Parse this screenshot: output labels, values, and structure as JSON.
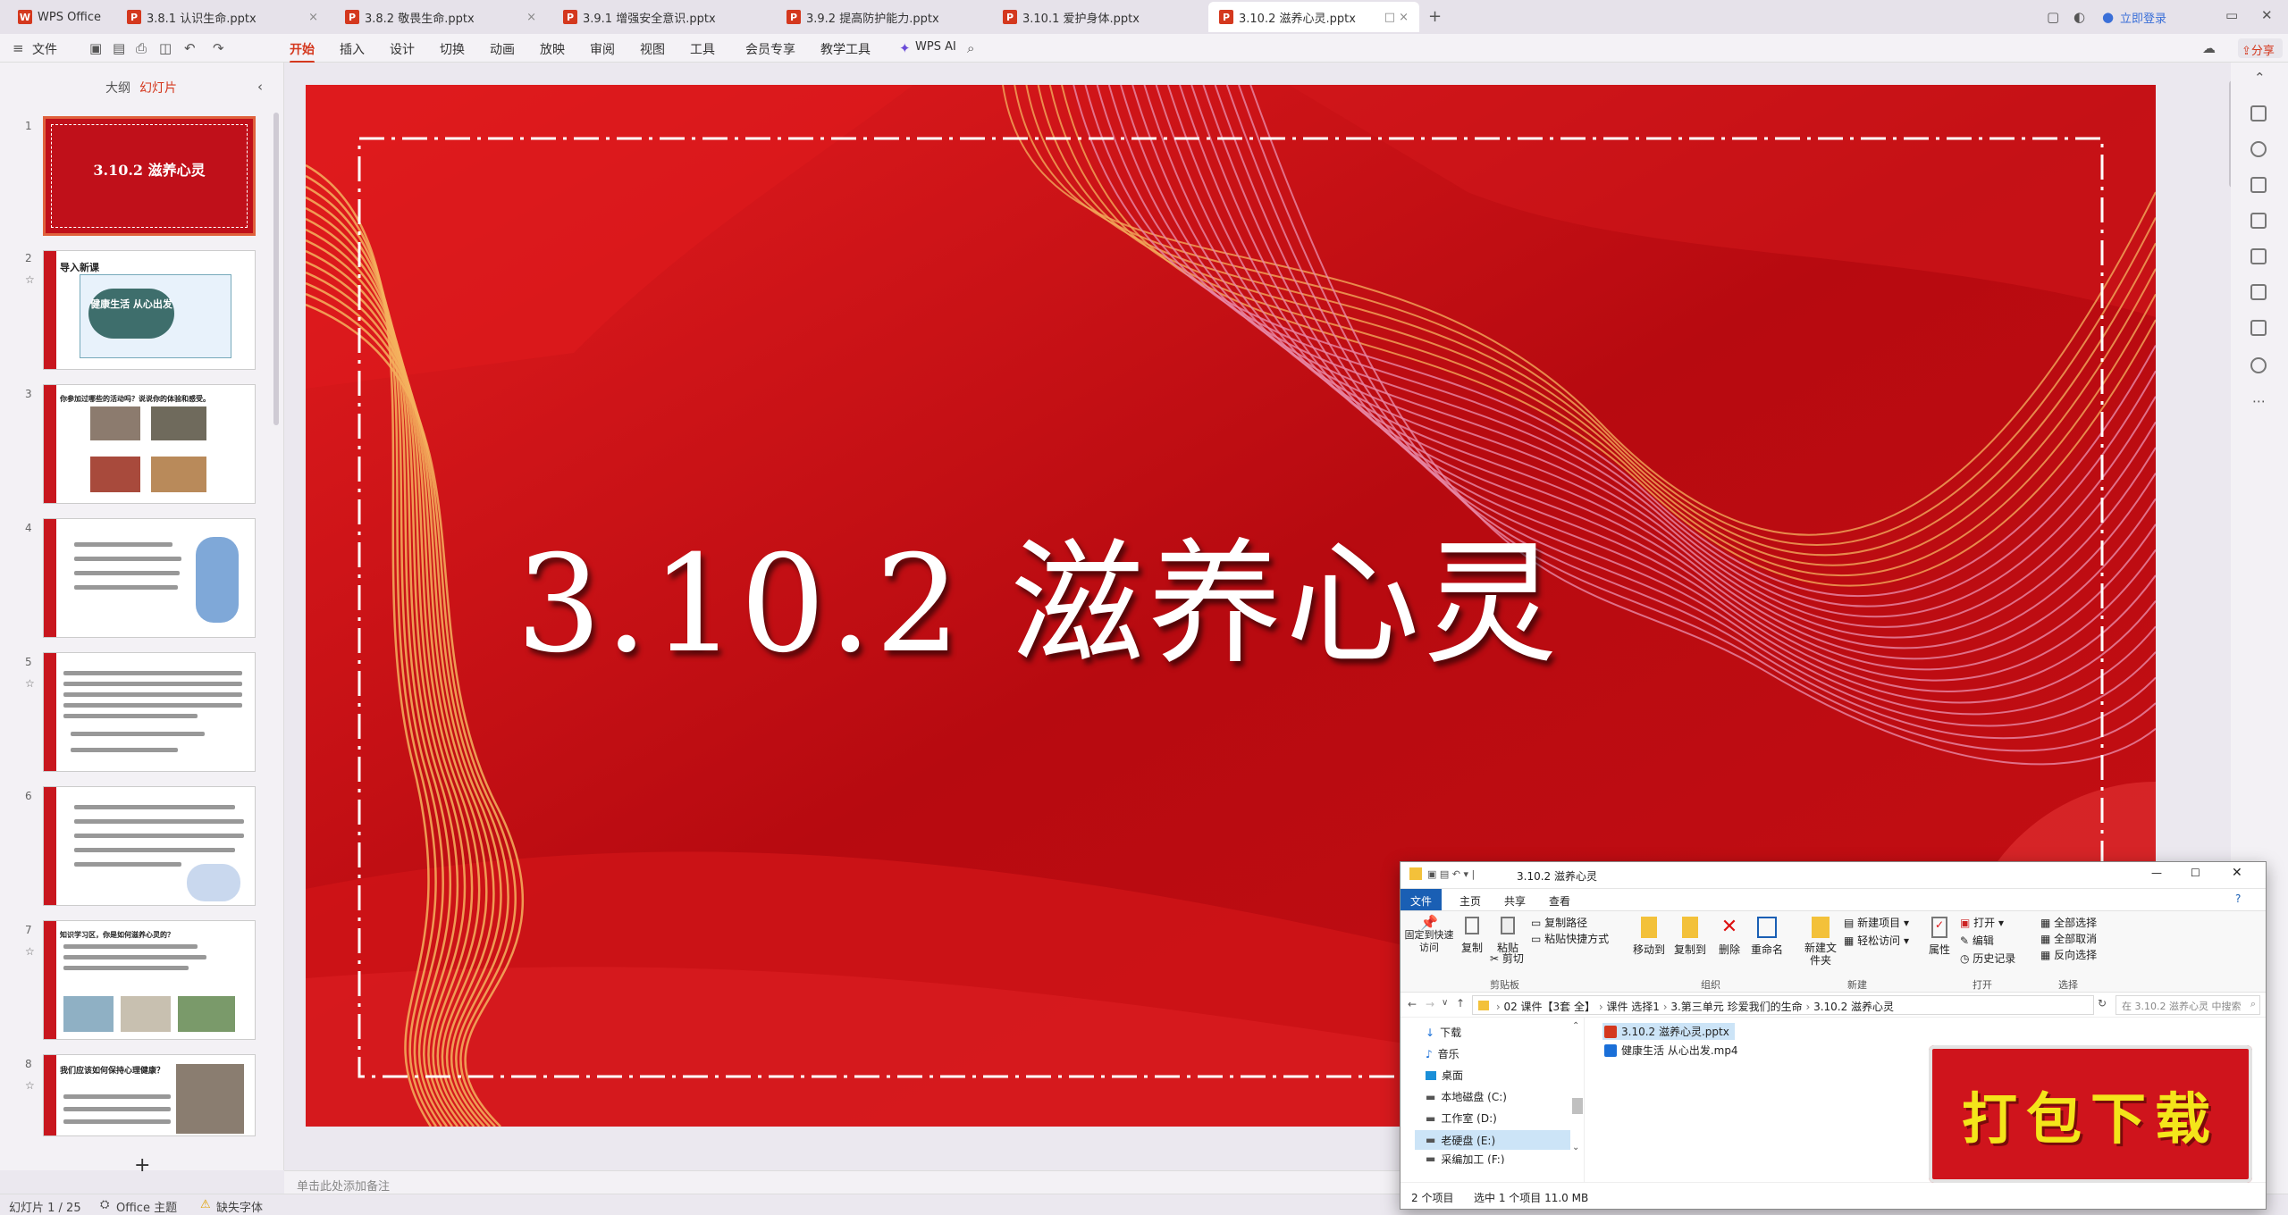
{
  "tabs": [
    {
      "label": "WPS Office"
    },
    {
      "label": "3.8.1 认识生命.pptx"
    },
    {
      "label": "3.8.2 敬畏生命.pptx"
    },
    {
      "label": "3.9.1 增强安全意识.pptx"
    },
    {
      "label": "3.9.2 提高防护能力.pptx"
    },
    {
      "label": "3.10.1 爱护身体.pptx"
    },
    {
      "label": "3.10.2 滋养心灵.pptx"
    }
  ],
  "top_right": {
    "login": "立即登录",
    "share": "分享"
  },
  "menu": {
    "file": "文件",
    "items": [
      "开始",
      "插入",
      "设计",
      "切换",
      "动画",
      "放映",
      "审阅",
      "视图",
      "工具",
      "会员专享",
      "教学工具"
    ],
    "wps_ai": "WPS AI"
  },
  "panel": {
    "outline": "大纲",
    "slides": "幻灯片",
    "add": "+"
  },
  "thumbnails": [
    {
      "num": "1",
      "title": "3.10.2  滋养心灵"
    },
    {
      "num": "2",
      "title": "导入新课",
      "badge": "健康生活 从心出发"
    },
    {
      "num": "3",
      "title": "你参加过哪些的活动吗？说说你的体验和感受。"
    },
    {
      "num": "4",
      "title": ""
    },
    {
      "num": "5",
      "title": ""
    },
    {
      "num": "6",
      "title": ""
    },
    {
      "num": "7",
      "title": "知识学习区，你是如何滋养心灵的？"
    },
    {
      "num": "8",
      "title": "我们应该如何保持心理健康？"
    }
  ],
  "slide": {
    "title": "3.10.2    滋养心灵"
  },
  "notes": {
    "placeholder": "单击此处添加备注"
  },
  "status": {
    "slide_count": "幻灯片 1 / 25",
    "theme": "Office 主题",
    "font_missing": "缺失字体"
  },
  "explorer": {
    "title": "3.10.2 滋养心灵",
    "ribbon_tabs": [
      "文件",
      "主页",
      "共享",
      "查看"
    ],
    "buttons": {
      "pin": "固定到快速访问",
      "copy": "复制",
      "paste": "粘贴",
      "copy_path": "复制路径",
      "paste_shortcut": "粘贴快捷方式",
      "cut": "剪切",
      "move_to": "移动到",
      "copy_to": "复制到",
      "delete": "删除",
      "rename": "重命名",
      "new_folder": "新建文件夹",
      "new_item": "新建项目",
      "easy_access": "轻松访问",
      "properties": "属性",
      "open": "打开",
      "edit": "编辑",
      "history": "历史记录",
      "select_all": "全部选择",
      "select_none": "全部取消",
      "invert": "反向选择"
    },
    "groups": [
      "剪贴板",
      "组织",
      "新建",
      "打开",
      "选择"
    ],
    "breadcrumb": [
      "02 课件【3套 全】",
      "课件 选择1",
      "3.第三单元 珍爱我们的生命",
      "3.10.2 滋养心灵"
    ],
    "search_placeholder": "在 3.10.2 滋养心灵 中搜索",
    "nav": [
      "下载",
      "音乐",
      "桌面",
      "本地磁盘 (C:)",
      "工作室 (D:)",
      "老硬盘 (E:)",
      "采编加工 (F:)"
    ],
    "files": [
      "3.10.2 滋养心灵.pptx",
      "健康生活 从心出发.mp4"
    ],
    "status": {
      "items": "2 个项目",
      "selected": "选中 1 个项目  11.0 MB"
    }
  },
  "stamp": {
    "text": "打包下载"
  }
}
